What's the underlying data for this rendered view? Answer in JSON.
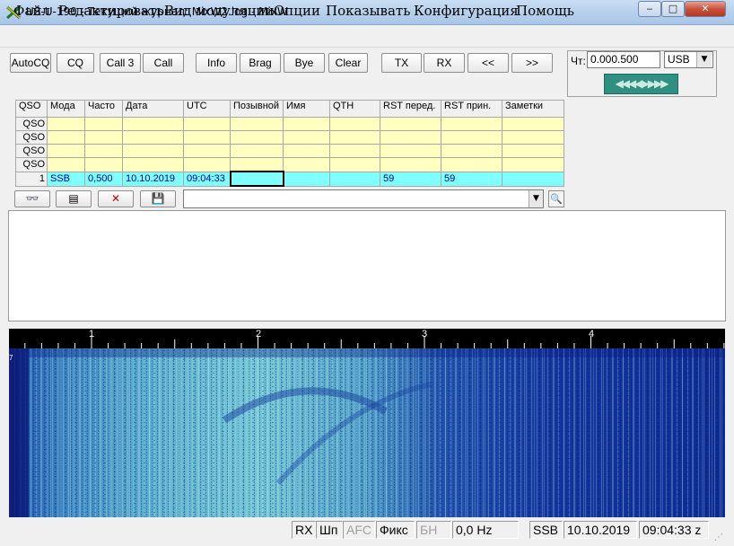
{
  "window": {
    "title": "US-U-190 - Текущий журнал: MixW2.log - MixW",
    "controls": {
      "minimize": "‒",
      "maximize": "□",
      "close": "✕"
    }
  },
  "menu": [
    "Файл",
    "Редактировать",
    "Вид модуляции",
    "Опции",
    "Показывать",
    "Конфигурация",
    "Помощь"
  ],
  "toolbar": {
    "buttons": [
      "AutoCQ",
      "CQ",
      "Call 3",
      "Call",
      "Info",
      "Brag",
      "Bye",
      "Clear",
      "TX",
      "RX",
      "<<",
      ">>"
    ]
  },
  "radio": {
    "freq_label": "Чт:",
    "freq_value": "0.000.500",
    "mode_value": "USB",
    "tuner_glyphs": "◀◀◀◀▶▶▶▶"
  },
  "log": {
    "columns": [
      "QSO",
      "Мода",
      "Часто",
      "Дата",
      "UTC",
      "Позывной",
      "Имя",
      "QTH",
      "RST перед.",
      "RST прин.",
      "Заметки"
    ],
    "rows": [
      {
        "num": "QSO",
        "cells": [
          "",
          "",
          "",
          "",
          "",
          "",
          "",
          "",
          "",
          ""
        ]
      },
      {
        "num": "QSO",
        "cells": [
          "",
          "",
          "",
          "",
          "",
          "",
          "",
          "",
          "",
          ""
        ]
      },
      {
        "num": "QSO",
        "cells": [
          "",
          "",
          "",
          "",
          "",
          "",
          "",
          "",
          "",
          ""
        ]
      },
      {
        "num": "QSO",
        "cells": [
          "",
          "",
          "",
          "",
          "",
          "",
          "",
          "",
          "",
          ""
        ]
      }
    ],
    "current": {
      "num": "1",
      "cells": [
        "SSB",
        "0,500",
        "10.10.2019",
        "09:04:33",
        "",
        "",
        "",
        "59",
        "59",
        ""
      ]
    }
  },
  "log_controls": {
    "icons": [
      "glasses-icon",
      "notepad-icon",
      "delete-x-icon",
      "save-disk-icon"
    ],
    "glyphs": [
      "👓",
      "▤",
      "✕",
      "💾"
    ],
    "search_value": "",
    "search_glyph": "🔍"
  },
  "waterfall": {
    "scale_labels": [
      "1",
      "2",
      "3",
      "4"
    ],
    "marker": "7",
    "colors": {
      "background": "#0a1a8c",
      "signal": "#a8e8e0",
      "scale_bg": "#000000"
    }
  },
  "statusbar": {
    "rx": "RX",
    "shp": "Шп",
    "afc": "AFC",
    "fix": "Фикс",
    "bn": "БН",
    "freq": "0,0 Hz",
    "mode": "SSB",
    "date": "10.10.2019",
    "time": "09:04:33 z"
  }
}
